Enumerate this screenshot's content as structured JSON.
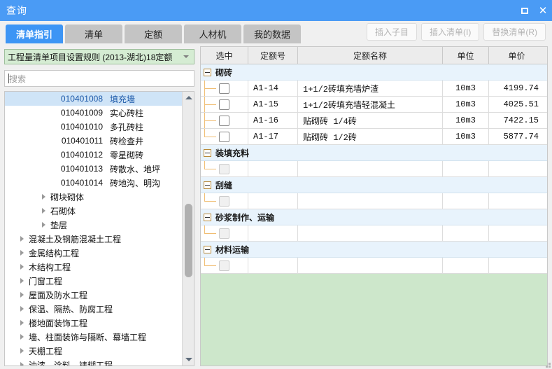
{
  "window": {
    "title": "查询",
    "maximize_icon": "maximize-icon",
    "close_icon": "close-icon"
  },
  "tabs": [
    {
      "label": "清单指引",
      "active": true
    },
    {
      "label": "清单",
      "active": false
    },
    {
      "label": "定额",
      "active": false
    },
    {
      "label": "人材机",
      "active": false
    },
    {
      "label": "我的数据",
      "active": false
    }
  ],
  "toolbar": {
    "buttons": [
      {
        "label": "插入子目",
        "disabled": true
      },
      {
        "label": "插入清单(I)",
        "disabled": true
      },
      {
        "label": "替换清单(R)",
        "disabled": true
      }
    ]
  },
  "left_panel": {
    "rule_select": {
      "value": "工程量清单项目设置规则 (2013-湖北)18定额",
      "chevron_icon": "chevron-down-icon"
    },
    "search": {
      "placeholder": "搜索",
      "value": ""
    },
    "tree": {
      "leaves": [
        {
          "code": "010401008",
          "name": "填充墙",
          "selected": true
        },
        {
          "code": "010401009",
          "name": "实心砖柱",
          "selected": false
        },
        {
          "code": "010401010",
          "name": "多孔砖柱",
          "selected": false
        },
        {
          "code": "010401011",
          "name": "砖检查井",
          "selected": false
        },
        {
          "code": "010401012",
          "name": "零星砌砖",
          "selected": false
        },
        {
          "code": "010401013",
          "name": "砖散水、地坪",
          "selected": false
        },
        {
          "code": "010401014",
          "name": "砖地沟、明沟",
          "selected": false
        }
      ],
      "sub_nodes": [
        {
          "label": "砌块砌体"
        },
        {
          "label": "石砌体"
        },
        {
          "label": "垫层"
        }
      ],
      "top_nodes": [
        {
          "label": "混凝土及钢筋混凝土工程"
        },
        {
          "label": "金属结构工程"
        },
        {
          "label": "木结构工程"
        },
        {
          "label": "门窗工程"
        },
        {
          "label": "屋面及防水工程"
        },
        {
          "label": "保温、隔热、防腐工程"
        },
        {
          "label": "楼地面装饰工程"
        },
        {
          "label": "墙、柱面装饰与隔断、幕墙工程"
        },
        {
          "label": "天棚工程"
        },
        {
          "label": "油漆、涂料、裱糊工程"
        }
      ],
      "scroll_up_icon": "scroll-up-arrow-icon",
      "scroll_down_icon": "scroll-down-arrow-icon"
    }
  },
  "right_panel": {
    "columns": [
      {
        "key": "select",
        "label": "选中"
      },
      {
        "key": "code",
        "label": "定额号"
      },
      {
        "key": "name",
        "label": "定额名称"
      },
      {
        "key": "unit",
        "label": "单位"
      },
      {
        "key": "price",
        "label": "单价"
      }
    ],
    "groups": [
      {
        "title": "砌砖",
        "expanded": true,
        "rows": [
          {
            "checked": false,
            "disabled": false,
            "code": "A1-14",
            "name": "1+1/2砖填充墙炉渣",
            "unit": "10m3",
            "price": "4199.74"
          },
          {
            "checked": false,
            "disabled": false,
            "code": "A1-15",
            "name": "1+1/2砖填充墙轻混凝土",
            "unit": "10m3",
            "price": "4025.51"
          },
          {
            "checked": false,
            "disabled": false,
            "code": "A1-16",
            "name": "贴砌砖 1/4砖",
            "unit": "10m3",
            "price": "7422.15"
          },
          {
            "checked": false,
            "disabled": false,
            "code": "A1-17",
            "name": "贴砌砖 1/2砖",
            "unit": "10m3",
            "price": "5877.74"
          }
        ]
      },
      {
        "title": "装填充料",
        "expanded": true,
        "rows": [
          {
            "checked": false,
            "disabled": true,
            "code": "",
            "name": "",
            "unit": "",
            "price": ""
          }
        ]
      },
      {
        "title": "刮缝",
        "expanded": true,
        "rows": [
          {
            "checked": false,
            "disabled": true,
            "code": "",
            "name": "",
            "unit": "",
            "price": ""
          }
        ]
      },
      {
        "title": "砂浆制作、运输",
        "expanded": true,
        "rows": [
          {
            "checked": false,
            "disabled": true,
            "code": "",
            "name": "",
            "unit": "",
            "price": ""
          }
        ]
      },
      {
        "title": "材料运输",
        "expanded": true,
        "rows": [
          {
            "checked": false,
            "disabled": true,
            "code": "",
            "name": "",
            "unit": "",
            "price": ""
          }
        ]
      }
    ]
  },
  "colors": {
    "titlebar": "#4a9bf5",
    "tab_active": "#3d95f5",
    "tab_inactive": "#c4c4c4",
    "group_row": "#e8f3fc",
    "selection": "#cfe4f7",
    "dropdown_green": "#d5ecd3",
    "empty_area_green": "#cde7cb",
    "tree_connector": "#f0bd72"
  }
}
